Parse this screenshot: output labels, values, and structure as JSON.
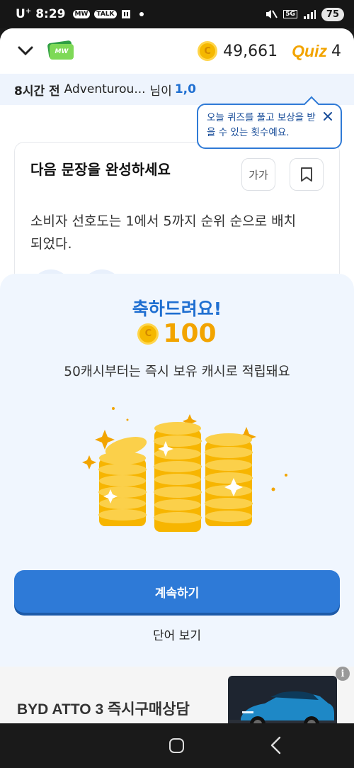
{
  "status_bar": {
    "carrier": "U",
    "carrier_sup": "+",
    "time": "8:29",
    "mini_icons": [
      "MW",
      "TALK"
    ],
    "network": "5G",
    "battery": "75"
  },
  "header": {
    "coins": "49,661",
    "quiz_label": "Quiz",
    "quiz_count": "4",
    "logo_text": "MW"
  },
  "notice": {
    "time_ago": "8시간 전",
    "user": "Adventurou...",
    "suffix": "님이",
    "highlight": "1,0"
  },
  "tooltip": {
    "text": "오늘 퀴즈를 풀고 보상을 받을 수 있는 횟수예요."
  },
  "question": {
    "title": "다음 문장을 완성하세요",
    "font_button": "가가",
    "sentence": "소비자 선호도는 1에서 5까지 순위 순으로 배치되었다."
  },
  "reward_sheet": {
    "congrats": "축하드려요!",
    "amount": "100",
    "coin_symbol": "C",
    "info": "50캐시부터는 즉시 보유 캐시로 적립돼요",
    "continue_label": "계속하기",
    "words_label": "단어 보기"
  },
  "ad": {
    "headline": "BYD ATTO 3  즉시구매상담",
    "info_symbol": "i"
  },
  "colors": {
    "accent": "#2e7ad7",
    "coin": "#f2a400",
    "sheet_bg": "#f0f6fe"
  }
}
